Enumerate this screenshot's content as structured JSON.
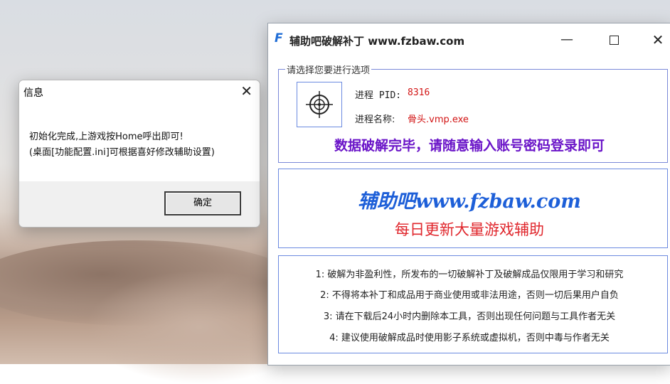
{
  "message_box": {
    "title": "信息",
    "close_glyph": "✕",
    "line1": "初始化完成,上游戏按Home呼出即可!",
    "line2": "(桌面[功能配置.ini]可根据喜好修改辅助设置)",
    "ok_label": "确定"
  },
  "main_window": {
    "icon_glyph": "F",
    "title": "辅助吧破解补丁 www.fzbaw.com",
    "minimize_glyph": "—",
    "close_glyph": "✕",
    "group_label": "请选择您要进行选项",
    "pid_label": "进程 PID:",
    "pid_value": "8316",
    "process_name_label": "进程名称:",
    "process_name_value": "骨头.vmp.exe",
    "status_text": "数据破解完毕，请随意输入账号密码登录即可",
    "banner_line1": "辅助吧www.fzbaw.com",
    "banner_line2": "每日更新大量游戏辅助",
    "notices": [
      "1: 破解为非盈利性，所发布的一切破解补丁及破解成品仅限用于学习和研究",
      "2: 不得将本补丁和成品用于商业使用或非法用途，否则一切后果用户自负",
      "3: 请在下载后24小时内删除本工具，否则出现任何问题与工具作者无关",
      "4: 建议使用破解成品时使用影子系统或虚拟机，否则中毒与作者无关"
    ]
  },
  "colors": {
    "accent_blue": "#1d5fd8",
    "status_purple": "#6a14c8",
    "value_red": "#d21414",
    "banner_red": "#e0262c"
  },
  "icons": [
    "close-icon",
    "crosshair-icon",
    "app-logo-icon",
    "minimize-icon",
    "maximize-icon"
  ]
}
